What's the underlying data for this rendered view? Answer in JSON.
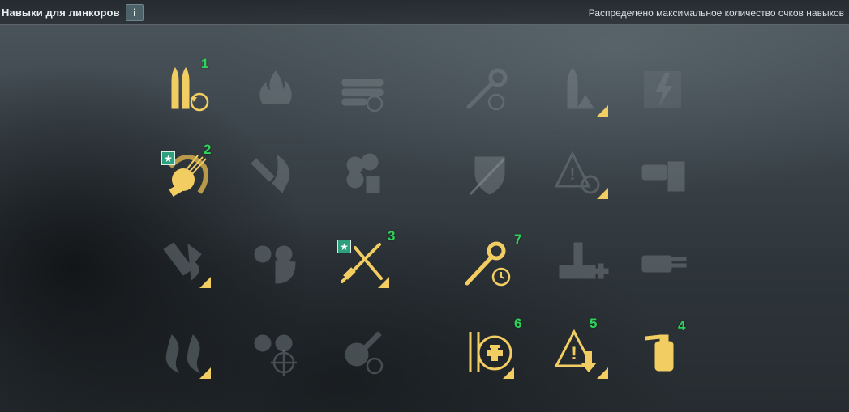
{
  "header": {
    "title": "Навыки для линкоров",
    "info_label": "i",
    "status": "Распределено максимальное количество очков навыков"
  },
  "colors": {
    "active": "#f2cd62",
    "inactive": "#7d868b",
    "number": "#2fd35b",
    "star_badge": "#2fa07e"
  },
  "skills": [
    {
      "id": "r1c1",
      "icon": "ammo-reload-icon",
      "active": true,
      "order": "1"
    },
    {
      "id": "r1c2",
      "icon": "fire-icon",
      "active": false
    },
    {
      "id": "r1c3",
      "icon": "torpedo-reload-icon",
      "active": false
    },
    {
      "id": "r1c4",
      "icon": "wrench-reload-icon",
      "active": false
    },
    {
      "id": "r1c5",
      "icon": "shell-warning-icon",
      "active": false
    },
    {
      "id": "r1c6",
      "icon": "lightning-icon",
      "active": false
    },
    {
      "id": "r2c1",
      "icon": "aa-gun-icon",
      "active": true,
      "order": "2",
      "star": "★"
    },
    {
      "id": "r2c2",
      "icon": "fire-shield-icon",
      "active": false
    },
    {
      "id": "r2c3",
      "icon": "fan-icon",
      "active": false
    },
    {
      "id": "r2c4",
      "icon": "sword-shield-icon",
      "active": false
    },
    {
      "id": "r2c5",
      "icon": "warning-target-icon",
      "active": false
    },
    {
      "id": "r2c6",
      "icon": "turret-armor-icon",
      "active": false
    },
    {
      "id": "r3c1",
      "icon": "shell-explosion-icon",
      "active": false
    },
    {
      "id": "r3c2",
      "icon": "shells-radar-icon",
      "active": false
    },
    {
      "id": "r3c3",
      "icon": "crossed-tools-icon",
      "active": true,
      "order": "3",
      "star": "★"
    },
    {
      "id": "r3c4",
      "icon": "wrench-timer-icon",
      "active": true,
      "order": "7"
    },
    {
      "id": "r3c5",
      "icon": "ship-heal-icon",
      "active": false
    },
    {
      "id": "r3c6",
      "icon": "turret-icon",
      "active": false
    },
    {
      "id": "r4c1",
      "icon": "flames-icon",
      "active": false
    },
    {
      "id": "r4c2",
      "icon": "shells-crosshair-icon",
      "active": false
    },
    {
      "id": "r4c3",
      "icon": "aa-reload-icon",
      "active": false
    },
    {
      "id": "r4c4",
      "icon": "tools-heal-icon",
      "active": true,
      "order": "6"
    },
    {
      "id": "r4c5",
      "icon": "warning-down-icon",
      "active": true,
      "order": "5"
    },
    {
      "id": "r4c6",
      "icon": "extinguisher-icon",
      "active": true,
      "order": "4"
    }
  ]
}
